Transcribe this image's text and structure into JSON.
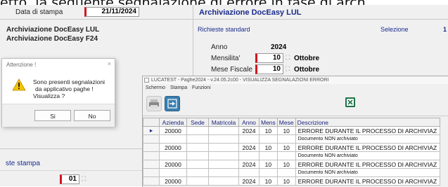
{
  "overlay_text": "etto, la seguente segnalazione di errore in fase di arch",
  "left": {
    "date_label": "Data di stampa",
    "date_value": "21/11/2024",
    "items": [
      "Archiviazione DocEasy LUL",
      "Archiviazione DocEasy F24"
    ],
    "section_label": "ste stampa",
    "number_value": "01"
  },
  "right": {
    "title": "Archiviazione DocEasy LUL",
    "tab_label": "Richieste standard",
    "tab_label2": "Selezione",
    "tab_count": "1",
    "anno_label": "Anno",
    "anno_value": "2024",
    "mensilita_label": "Mensilita'",
    "mensilita_value": "10",
    "mensilita_month": "Ottobre",
    "mese_fiscale_label": "Mese Fiscale",
    "mese_fiscale_value": "10",
    "mese_fiscale_month": "Ottobre"
  },
  "dialog": {
    "title": "Attenzione !",
    "close": "×",
    "message": [
      "Sono presenti segnalazioni",
      "da applicativo paghe !",
      "Visualizza ?"
    ],
    "yes": "Si",
    "no": "No"
  },
  "window": {
    "title": "LUCATEST - Paghe2024 - v.24.05.2c00 - VISUALIZZA SEGNALAZIONI ERRORI",
    "menu": [
      "Schermo",
      "Stampa",
      "Funzioni"
    ],
    "columns": [
      "Azienda",
      "Sede",
      "Matricola",
      "Anno",
      "Mens",
      "Mese",
      "Descrizione"
    ],
    "rows": [
      {
        "azienda": "20000",
        "sede": "",
        "matricola": "",
        "anno": "2024",
        "mens": "10",
        "mese": "10",
        "desc": "ERRORE DURANTE IL PROCESSO DI ARCHIVIAZ"
      },
      {
        "azienda": "",
        "sede": "",
        "matricola": "",
        "anno": "",
        "mens": "",
        "mese": "",
        "desc": "Documento NON archiviato"
      },
      {
        "azienda": "20000",
        "sede": "",
        "matricola": "",
        "anno": "2024",
        "mens": "10",
        "mese": "10",
        "desc": "ERRORE DURANTE IL PROCESSO DI ARCHIVIAZ"
      },
      {
        "azienda": "",
        "sede": "",
        "matricola": "",
        "anno": "",
        "mens": "",
        "mese": "",
        "desc": "Documento NON archiviato"
      },
      {
        "azienda": "20000",
        "sede": "",
        "matricola": "",
        "anno": "2024",
        "mens": "10",
        "mese": "10",
        "desc": "ERRORE DURANTE IL PROCESSO DI ARCHIVIAZ"
      },
      {
        "azienda": "",
        "sede": "",
        "matricola": "",
        "anno": "",
        "mens": "",
        "mese": "",
        "desc": "Documento NON archiviato"
      },
      {
        "azienda": "20000",
        "sede": "",
        "matricola": "",
        "anno": "2024",
        "mens": "10",
        "mese": "10",
        "desc": "ERRORE DURANTE IL PROCESSO DI ARCHIVIAZ"
      }
    ],
    "current_row_marker": "▸"
  }
}
